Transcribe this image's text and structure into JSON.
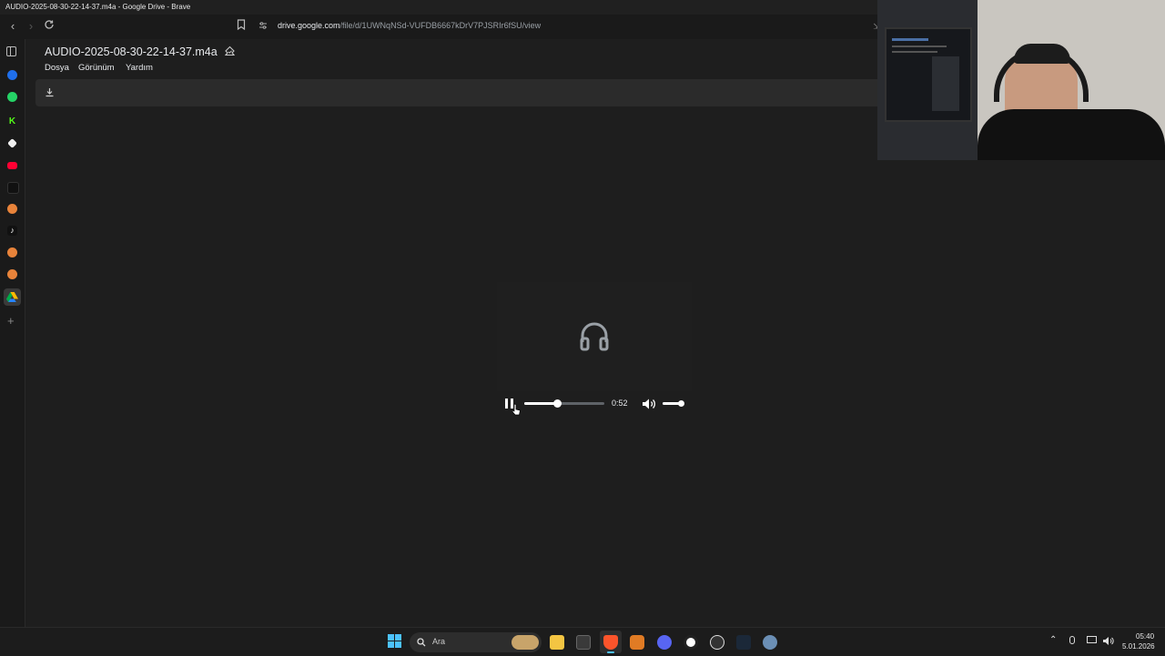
{
  "window": {
    "title": "AUDIO-2025-08-30-22-14-37.m4a - Google Drive - Brave"
  },
  "browser": {
    "url_host": "drive.google.com",
    "url_path": "/file/d/1UWNqNSd-VUFDB6667kDrV7PJSRIr6fSU/view"
  },
  "document": {
    "title": "AUDIO-2025-08-30-22-14-37.m4a",
    "menu": [
      "Dosya",
      "Görünüm",
      "Yardım"
    ]
  },
  "player": {
    "time": "0:52",
    "progress": 0.42,
    "volume": 0.85
  },
  "taskbar": {
    "search_placeholder": "Ara",
    "time": "05:40",
    "date": "5.01.2026"
  },
  "colors": {
    "accent": "#8ab4f8",
    "background": "#1e1e1e",
    "brave": "#fb542b"
  }
}
